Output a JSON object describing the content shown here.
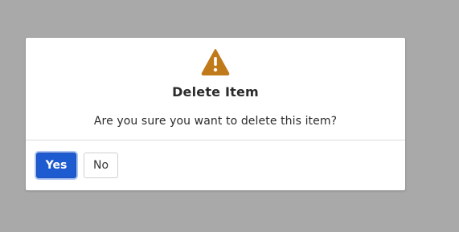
{
  "dialog": {
    "icon": "warning-icon",
    "title": "Delete Item",
    "message": "Are you sure you want to delete this item?",
    "buttons": {
      "yes_label": "Yes",
      "no_label": "No"
    }
  },
  "colors": {
    "overlay_background": "#a9a9a9",
    "warning_icon": "#c07a1a",
    "primary_button": "#1f5bd0"
  }
}
